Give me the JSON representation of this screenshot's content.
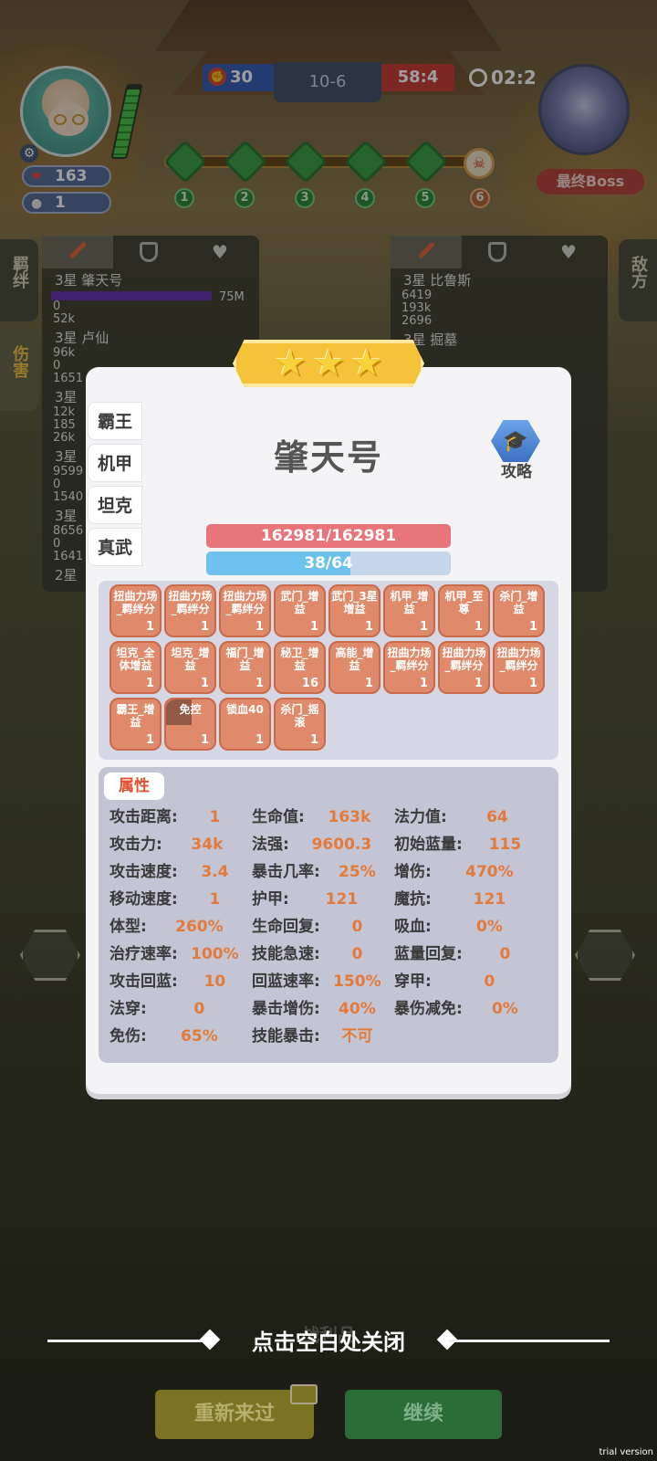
{
  "hud": {
    "player_hp": "163",
    "player_coins": "1",
    "left_score": "30",
    "round": "10-6",
    "right_score": "58:4",
    "timer": "02:2",
    "boss_label": "最终Boss",
    "stages": [
      "1",
      "2",
      "3",
      "4",
      "5",
      "6"
    ]
  },
  "side_tabs": {
    "left_top": "羁绊",
    "left_damage": "伤害",
    "right": "敌方"
  },
  "damage_left": {
    "rows": [
      {
        "name": "3星 肇天号",
        "value": "75M",
        "nums": [
          "0",
          "52k"
        ]
      },
      {
        "name": "3星 卢仙",
        "nums": [
          "96k",
          "0",
          "1651"
        ]
      },
      {
        "name": "3星",
        "nums": [
          "12k",
          "185",
          "26k"
        ]
      },
      {
        "name": "3星",
        "nums": [
          "9599",
          "0",
          "1540"
        ]
      },
      {
        "name": "3星",
        "nums": [
          "8656",
          "0",
          "1641"
        ]
      },
      {
        "name": "2星"
      }
    ]
  },
  "damage_right": {
    "rows": [
      {
        "name": "3星 比鲁斯",
        "nums": [
          "6419",
          "193k",
          "2696"
        ]
      },
      {
        "name": "3星 掘墓"
      }
    ]
  },
  "modal": {
    "stars": 3,
    "title": "肇天号",
    "guide_label": "攻略",
    "categories": [
      "霸王",
      "机甲",
      "坦克",
      "真武"
    ],
    "hp_text": "162981/162981",
    "mp_text": "38/64",
    "mp_fraction": 0.59,
    "buffs": [
      {
        "label": "扭曲力场_羁绊分",
        "count": "1"
      },
      {
        "label": "扭曲力场_羁绊分",
        "count": "1"
      },
      {
        "label": "扭曲力场_羁绊分",
        "count": "1"
      },
      {
        "label": "武门_增益",
        "count": "1"
      },
      {
        "label": "武门_3星增益",
        "count": "1"
      },
      {
        "label": "机甲_增益",
        "count": "1"
      },
      {
        "label": "机甲_至尊",
        "count": "1"
      },
      {
        "label": "杀门_增益",
        "count": "1"
      },
      {
        "label": "坦克_全体增益",
        "count": "1"
      },
      {
        "label": "坦克_增益",
        "count": "1"
      },
      {
        "label": "福门_增益",
        "count": "1"
      },
      {
        "label": "秘卫_增益",
        "count": "16"
      },
      {
        "label": "高能_增益",
        "count": "1"
      },
      {
        "label": "扭曲力场_羁绊分",
        "count": "1"
      },
      {
        "label": "扭曲力场_羁绊分",
        "count": "1"
      },
      {
        "label": "扭曲力场_羁绊分",
        "count": "1"
      },
      {
        "label": "霸王_增益",
        "count": "1"
      },
      {
        "label": "免控",
        "count": "1"
      },
      {
        "label": "锁血40",
        "count": "1"
      },
      {
        "label": "杀门_摇滚",
        "count": "1"
      }
    ],
    "attr_title": "属性",
    "attributes": [
      {
        "k": "攻击距离:",
        "v": "1"
      },
      {
        "k": "生命值:",
        "v": "163k"
      },
      {
        "k": "法力值:",
        "v": "64"
      },
      {
        "k": "攻击力:",
        "v": "34k"
      },
      {
        "k": "法强:",
        "v": "9600.3"
      },
      {
        "k": "初始蓝量:",
        "v": "115"
      },
      {
        "k": "攻击速度:",
        "v": "3.4"
      },
      {
        "k": "暴击几率:",
        "v": "25%"
      },
      {
        "k": "增伤:",
        "v": "470%"
      },
      {
        "k": "移动速度:",
        "v": "1"
      },
      {
        "k": "护甲:",
        "v": "121"
      },
      {
        "k": "魔抗:",
        "v": "121"
      },
      {
        "k": "体型:",
        "v": "260%"
      },
      {
        "k": "生命回复:",
        "v": "0"
      },
      {
        "k": "吸血:",
        "v": "0%"
      },
      {
        "k": "治疗速率:",
        "v": "100%"
      },
      {
        "k": "技能急速:",
        "v": "0"
      },
      {
        "k": "蓝量回复:",
        "v": "0"
      },
      {
        "k": "攻击回蓝:",
        "v": "10"
      },
      {
        "k": "回蓝速率:",
        "v": "150%"
      },
      {
        "k": "穿甲:",
        "v": "0"
      },
      {
        "k": "法穿:",
        "v": "0"
      },
      {
        "k": "暴击增伤:",
        "v": "40%"
      },
      {
        "k": "暴伤减免:",
        "v": "0%"
      },
      {
        "k": "免伤:",
        "v": "65%"
      },
      {
        "k": "技能暴击:",
        "v": "不可"
      }
    ]
  },
  "bottom": {
    "close_hint": "点击空白处关闭",
    "ghost_text": "战利品",
    "retry_label": "重新来过",
    "continue_label": "继续",
    "trial": "trial version"
  }
}
